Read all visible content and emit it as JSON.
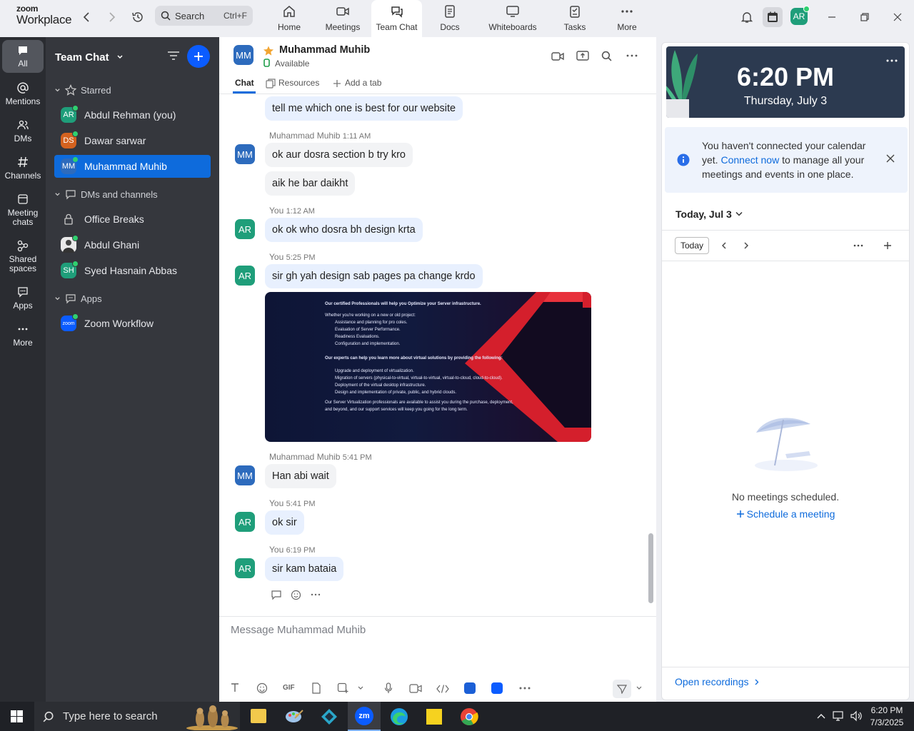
{
  "app": {
    "logo_top": "zoom",
    "logo_bottom": "Workplace"
  },
  "search": {
    "label": "Search",
    "shortcut": "Ctrl+F"
  },
  "nav_tabs": [
    {
      "label": "Home",
      "icon": "home-icon"
    },
    {
      "label": "Meetings",
      "icon": "video-icon"
    },
    {
      "label": "Team Chat",
      "icon": "chat-icon"
    },
    {
      "label": "Docs",
      "icon": "doc-icon"
    },
    {
      "label": "Whiteboards",
      "icon": "whiteboard-icon"
    },
    {
      "label": "Tasks",
      "icon": "tasks-icon"
    },
    {
      "label": "More",
      "icon": "more-icon"
    }
  ],
  "user": {
    "initials": "AR"
  },
  "rail": [
    {
      "label": "All"
    },
    {
      "label": "Mentions"
    },
    {
      "label": "DMs"
    },
    {
      "label": "Channels"
    },
    {
      "label": "Meeting chats"
    },
    {
      "label": "Shared spaces"
    },
    {
      "label": "Apps"
    },
    {
      "label": "More"
    }
  ],
  "sidebar": {
    "title": "Team Chat",
    "starred_label": "Starred",
    "dms_label": "DMs and channels",
    "apps_label": "Apps",
    "starred": [
      {
        "initials": "AR",
        "name": "Abdul Rehman (you)",
        "color": "#1f9e7a"
      },
      {
        "initials": "DS",
        "name": "Dawar sarwar",
        "color": "#d4621f"
      },
      {
        "initials": "MM",
        "name": "Muhammad Muhib",
        "color": "#2d6bbd"
      }
    ],
    "dms": [
      {
        "name": "Office Breaks"
      },
      {
        "name": "Abdul Ghani"
      },
      {
        "initials": "SH",
        "name": "Syed Hasnain Abbas",
        "color": "#1f9e7a"
      }
    ],
    "apps": [
      {
        "name": "Zoom Workflow",
        "badge": "zoom"
      }
    ]
  },
  "chat": {
    "contact_initials": "MM",
    "contact_name": "Muhammad Muhib",
    "status": "Available",
    "tabs": {
      "chat": "Chat",
      "resources": "Resources",
      "add": "Add a tab"
    },
    "messages": {
      "m0": "tell me which one is best for our website",
      "h1": "Muhammad Muhib",
      "h1t": "1:11 AM",
      "m1a": "ok aur dosra section b try kro",
      "m1b": "aik he bar daikht",
      "h2": "You",
      "h2t": "1:12 AM",
      "m2": "ok ok who dosra bh design krta",
      "h3": "You",
      "h3t": "5:25 PM",
      "m3": "sir gh yah design sab pages pa change krdo",
      "h4": "Muhammad Muhib",
      "h4t": "5:41 PM",
      "m4": "Han abi wait",
      "h5": "You",
      "h5t": "5:41 PM",
      "m5": "ok sir",
      "h6": "You",
      "h6t": "6:19 PM",
      "m6": "sir kam bataia"
    },
    "attachment": {
      "p1": "Our certified Professionals will help you Optimize your Server infrastructure.",
      "p2": "Whether you're working on a new or old project:",
      "b1": "Assistance and planning for pro coles.",
      "b2": "Evaluation of Server Performance.",
      "b3": "Readiness Evaluations.",
      "b4": "Configuration and implementation.",
      "p3": "Our experts can help you learn more about virtual solutions by providing the following:",
      "c1": "Upgrade and deployment of virtualization.",
      "c2": "Migration of servers (physical-to-virtual, virtual-to-virtual, virtual-to-cloud, cloud-to-cloud).",
      "c3": "Deployment of the virtual desktop infrastructure.",
      "c4": "Design and implementation of private, public, and hybrid clouds.",
      "p4": "Our Server Virtualization professionals are available to assist you during the purchase, deployment, and beyond, and our support services will keep you going for the long term."
    },
    "composer_placeholder": "Message Muhammad Muhib",
    "gif_label": "GIF"
  },
  "calendar": {
    "time": "6:20 PM",
    "date": "Thursday, July 3",
    "notice_a": "You haven't connected your calendar yet.",
    "notice_link": "Connect now",
    "notice_b": "to manage all your meetings and events in one place.",
    "day_label": "Today, Jul 3",
    "today_btn": "Today",
    "empty": "No meetings scheduled.",
    "schedule": "Schedule a meeting",
    "recordings": "Open recordings"
  },
  "taskbar": {
    "search": "Type here to search",
    "time": "6:20 PM",
    "date": "7/3/2025",
    "zoom_label": "zm"
  }
}
